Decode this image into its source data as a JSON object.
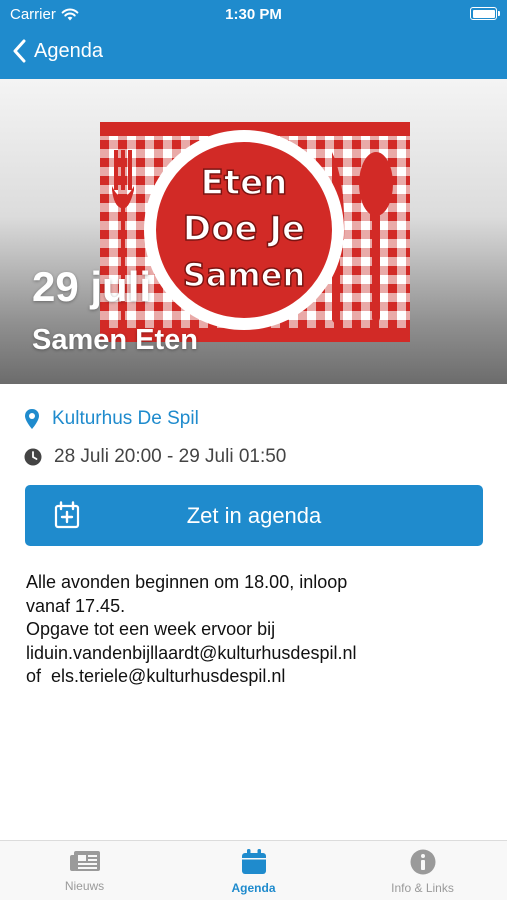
{
  "status_bar": {
    "carrier": "Carrier",
    "time": "1:30 PM"
  },
  "nav": {
    "back_label": "Agenda"
  },
  "hero": {
    "date": "29 juli",
    "title": "Samen Eten",
    "image_text": [
      "Eten",
      "Doe Je",
      "Samen"
    ]
  },
  "event": {
    "location": "Kulturhus De Spil",
    "time_range": "28 Juli 20:00 - 29 Juli 01:50",
    "add_to_calendar_label": "Zet in agenda",
    "description": [
      "Alle avonden beginnen om 18.00, inloop",
      "vanaf 17.45.",
      "Opgave tot een week ervoor bij",
      "liduin.vandenbijllaardt@kulturhusdespil.nl",
      "of  els.teriele@kulturhusdespil.nl"
    ]
  },
  "tabs": [
    {
      "label": "Nieuws",
      "icon": "newspaper-icon",
      "active": false
    },
    {
      "label": "Agenda",
      "icon": "calendar-icon",
      "active": true
    },
    {
      "label": "Info & Links",
      "icon": "info-icon",
      "active": false
    }
  ],
  "colors": {
    "accent": "#1f8bcd",
    "image_red": "#d22a26",
    "tab_inactive": "#9a9a9a"
  }
}
